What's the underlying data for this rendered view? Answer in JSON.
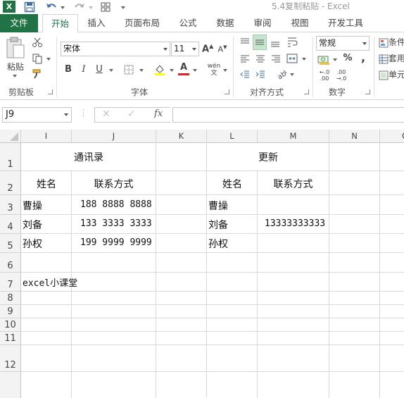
{
  "window": {
    "app_icon": "excel-icon",
    "title": "5.4复制粘贴 - Excel"
  },
  "quick_access": {
    "save_icon": "save-icon",
    "undo_icon": "undo-icon",
    "redo_icon": "redo-icon",
    "customize_icon": "customize-qat-icon"
  },
  "tabs": [
    {
      "label": "文件"
    },
    {
      "label": "开始"
    },
    {
      "label": "插入"
    },
    {
      "label": "页面布局"
    },
    {
      "label": "公式"
    },
    {
      "label": "数据"
    },
    {
      "label": "审阅"
    },
    {
      "label": "视图"
    },
    {
      "label": "开发工具"
    }
  ],
  "ribbon": {
    "clipboard": {
      "paste_label": "粘贴",
      "group_label": "剪贴板"
    },
    "font": {
      "font_name": "宋体",
      "font_size": "11",
      "group_label": "字体",
      "bold": "B",
      "italic": "I",
      "underline": "U",
      "font_color": "A",
      "phonetic": "wén"
    },
    "alignment": {
      "group_label": "对齐方式"
    },
    "number": {
      "format": "常规",
      "percent": "%",
      "comma": ",",
      "inc_decimal": ".0→.00",
      "dec_decimal": ".00→.0",
      "group_label": "数字"
    },
    "styles": {
      "conditional": "条件",
      "table": "套用",
      "cell": "单元"
    }
  },
  "formula_bar": {
    "name_box": "J9",
    "cancel": "✕",
    "enter": "✓",
    "fx": "fx",
    "formula": ""
  },
  "sheet": {
    "columns": [
      "I",
      "J",
      "K",
      "L",
      "M",
      "N",
      "O"
    ],
    "rows": [
      "1",
      "2",
      "3",
      "4",
      "5",
      "6",
      "7",
      "8",
      "9",
      "10",
      "11",
      "12"
    ],
    "cells": {
      "I1": "通讯录",
      "I2": "姓名",
      "J2": "联系方式",
      "I3": "曹操",
      "J3": "188 8888 8888",
      "I4": "刘备",
      "J4": "133 3333 3333",
      "I5": "孙权",
      "J5": "199 9999 9999",
      "L1": "更新",
      "L2": "姓名",
      "M2": "联系方式",
      "L3": "曹操",
      "L4": "刘备",
      "M4": "13333333333",
      "L5": "孙权",
      "I7": "excel小课堂"
    }
  }
}
